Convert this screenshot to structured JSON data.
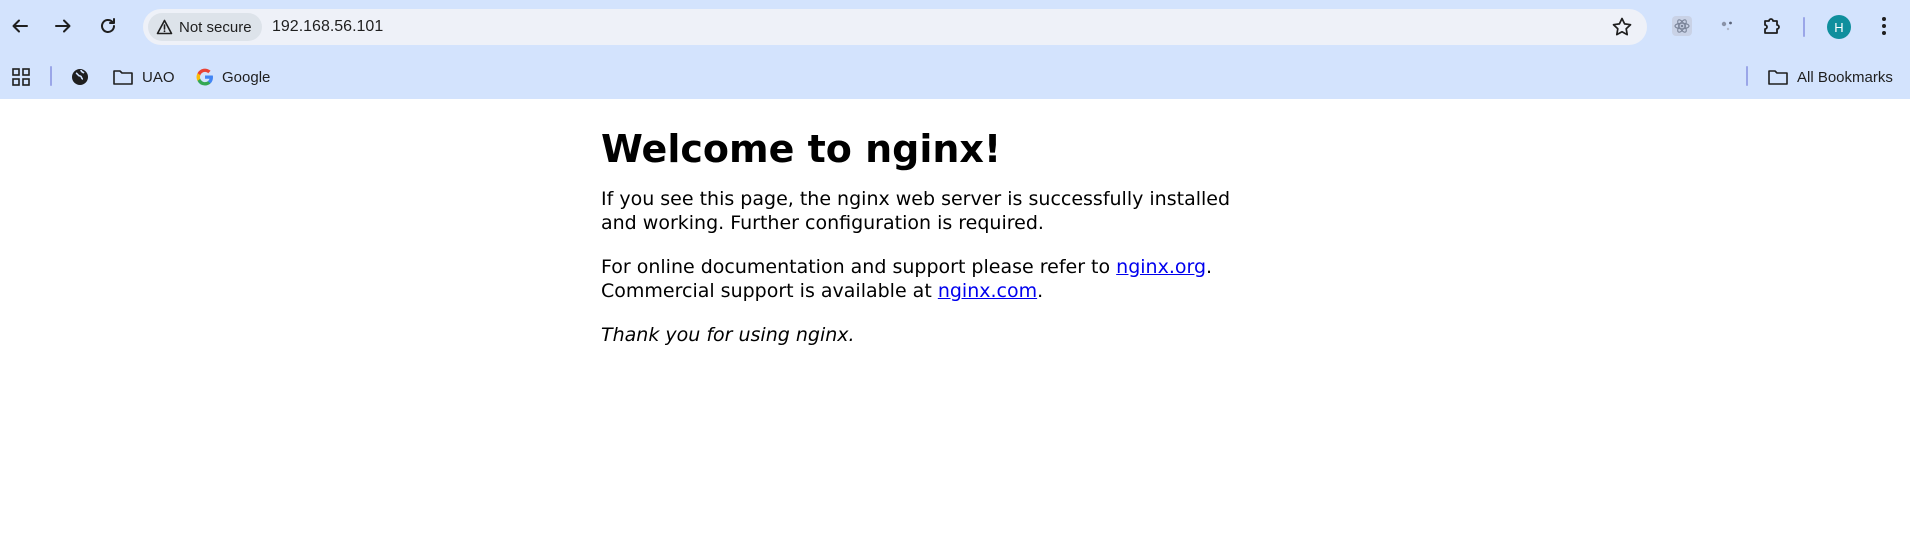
{
  "browser": {
    "security_label": "Not secure",
    "url": "192.168.56.101",
    "avatar_letter": "H",
    "accent_color": "#d3e3fd",
    "avatar_color": "#0f8f9d"
  },
  "bookmarks": {
    "items": [
      {
        "label": "UAO",
        "icon": "folder-icon"
      },
      {
        "label": "Google",
        "icon": "google-icon"
      }
    ],
    "all_bookmarks_label": "All Bookmarks"
  },
  "page": {
    "heading": "Welcome to nginx!",
    "p1": "If you see this page, the nginx web server is successfully installed and working. Further configuration is required.",
    "p2_prefix": "For online documentation and support please refer to ",
    "link_org": "nginx.org",
    "p2_mid": ".",
    "p2_line2_prefix": "Commercial support is available at ",
    "link_com": "nginx.com",
    "p2_suffix": ".",
    "thanks": "Thank you for using nginx."
  }
}
